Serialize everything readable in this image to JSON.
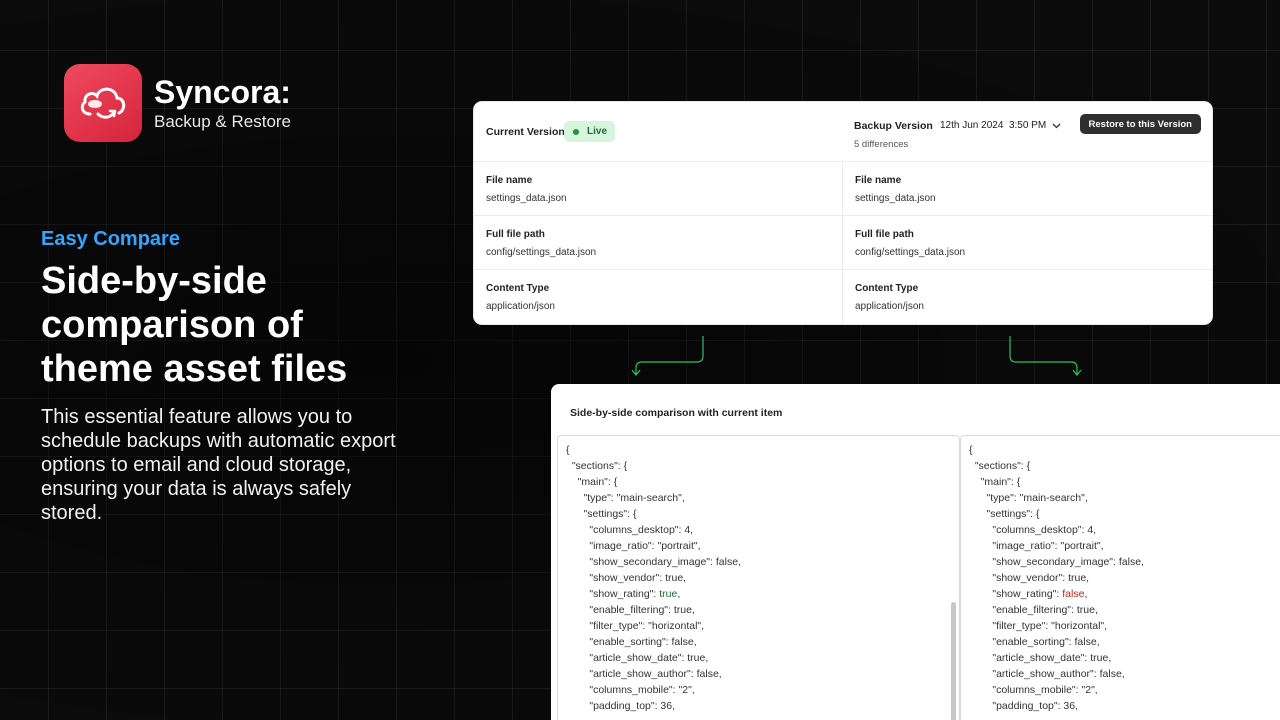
{
  "brand": {
    "name": "Syncora:",
    "subtitle": "Backup & Restore",
    "logo_icon": "cloud-sync-icon",
    "accent": "#e2334b"
  },
  "hero": {
    "eyebrow": "Easy Compare",
    "headline_lines": [
      "Side-by-side",
      "comparison of",
      "theme asset files"
    ],
    "description": "This essential feature allows you to schedule backups with automatic export options to email and cloud storage, ensuring your data is always safely stored.",
    "eyebrow_color": "#33a7ff"
  },
  "version_card": {
    "current_label": "Current Version",
    "live_badge": "Live",
    "backup_label": "Backup Version",
    "backup_date": "12th Jun 2024  3:50 PM",
    "differences": "5 differences",
    "restore_button": "Restore to this Version",
    "rows": [
      {
        "label": "File name",
        "current": "settings_data.json",
        "backup": "settings_data.json"
      },
      {
        "label": "Full file path",
        "current": "config/settings_data.json",
        "backup": "config/settings_data.json"
      },
      {
        "label": "Content Type",
        "current": "application/json",
        "backup": "application/json"
      }
    ]
  },
  "comparison": {
    "title": "Side-by-side comparison with current item",
    "left_lines": [
      "{",
      "  \"sections\": {",
      "    \"main\": {",
      "      \"type\": \"main-search\",",
      "      \"settings\": {",
      "        \"columns_desktop\": 4,",
      "        \"image_ratio\": \"portrait\",",
      "        \"show_secondary_image\": false,",
      "        \"show_vendor\": true,",
      "        \"show_rating\": true,",
      "        \"enable_filtering\": true,",
      "        \"filter_type\": \"horizontal\",",
      "        \"enable_sorting\": false,",
      "        \"article_show_date\": true,",
      "        \"article_show_author\": false,",
      "        \"columns_mobile\": \"2\",",
      "        \"padding_top\": 36,"
    ],
    "right_lines": [
      "{",
      "  \"sections\": {",
      "    \"main\": {",
      "      \"type\": \"main-search\",",
      "      \"settings\": {",
      "        \"columns_desktop\": 4,",
      "        \"image_ratio\": \"portrait\",",
      "        \"show_secondary_image\": false,",
      "        \"show_vendor\": true,",
      "        \"show_rating\": false,",
      "        \"enable_filtering\": true,",
      "        \"filter_type\": \"horizontal\",",
      "        \"enable_sorting\": false,",
      "        \"article_show_date\": true,",
      "        \"article_show_author\": false,",
      "        \"columns_mobile\": \"2\",",
      "        \"padding_top\": 36,"
    ],
    "diff_line_index": 9,
    "diff_current_color": "#1f6b33",
    "diff_backup_color": "#b3261e"
  }
}
